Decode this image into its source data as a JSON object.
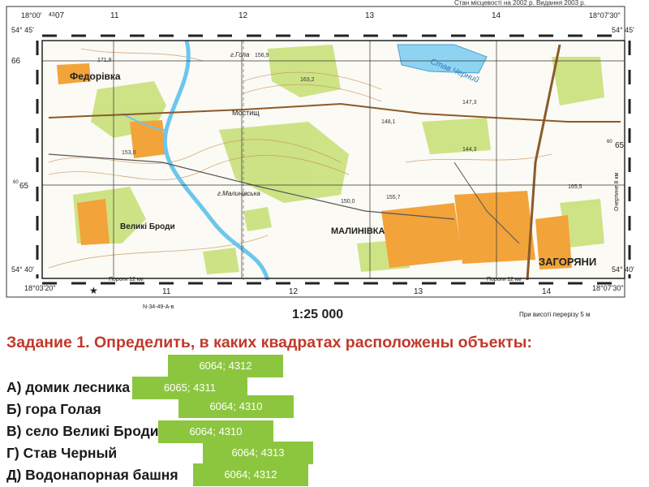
{
  "map": {
    "top_note": "Стан місцевості на 2002 р. Видання 2003 р.",
    "corner_tl_lon": "18°00'",
    "corner_tr_lon": "18°07'30\"",
    "corner_bl_lon": "18°03'20\"",
    "corner_br_lon": "18°07'30\"",
    "corner_lat_top_left": "54° 45'",
    "corner_lat_top_right": "54° 45'",
    "corner_lat_bot_left": "54° 40'",
    "corner_lat_bot_right": "54° 40'",
    "small_43": "43",
    "grid_top": [
      "07",
      "11",
      "12",
      "13",
      "14"
    ],
    "grid_bottom": [
      "11",
      "12",
      "13",
      "14"
    ],
    "grid_left": [
      "66",
      "65"
    ],
    "grid_right": [
      "65"
    ],
    "coord_60": "60",
    "roads": [
      "Пороги 12 км",
      "Пороги 12 км"
    ],
    "side_note": "Очертине 8 км",
    "scale": "1:25 000",
    "relief": "При висоті перерізу 5 м",
    "sheet": "N-34-49-А-в",
    "places": {
      "fedorivka": "Федорівка",
      "malynivka": "МАЛИНІВКА",
      "zahoriany": "ЗАГОРЯНИ",
      "veliki_brody": "Великі Броди",
      "gora_hola": "г.Гола",
      "gora_malynivska": "г.Малинівська",
      "stav": "Став Черний",
      "mostyshche": "Мостищ"
    },
    "spot_heights": [
      "171,8",
      "156,9",
      "163,2",
      "147,3",
      "144,3",
      "155,7",
      "153,0",
      "165,5",
      "148,1",
      "150,0"
    ]
  },
  "task": {
    "title": "Задание 1.  Определить, в каких квадратах расположены объекты:",
    "items": [
      "А) домик лесника",
      "Б) гора Голая",
      "В) село Великі Броди",
      "Г) Став Черный",
      "Д) Водонапорная башня"
    ],
    "answers": [
      "6064; 4312",
      "6065; 4311",
      "6064; 4310",
      "6064; 4310",
      "6064; 4313",
      "6064; 4312"
    ]
  }
}
